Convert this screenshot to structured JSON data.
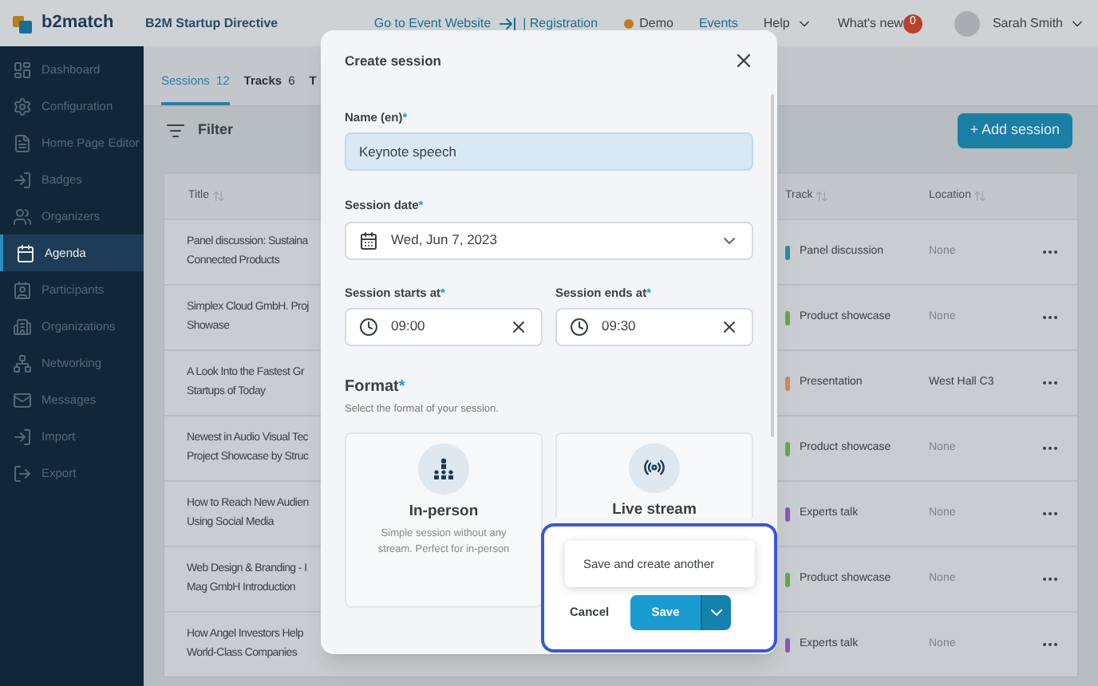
{
  "topbar": {
    "logo": "b2match",
    "event": "B2M Startup Directive",
    "links": [
      {
        "kind": "website",
        "label": "Go to Event Website"
      },
      {
        "kind": "registration",
        "label": "| Registration"
      },
      {
        "kind": "demo",
        "label": "Demo"
      },
      {
        "kind": "plain",
        "label": "Events"
      },
      {
        "kind": "menu",
        "label": "Help"
      },
      {
        "kind": "news",
        "label": "What's new",
        "badge": "0"
      }
    ],
    "user": "Sarah Smith"
  },
  "sidebar": {
    "items": [
      {
        "label": "Dashboard",
        "selected": false
      },
      {
        "label": "Configuration",
        "selected": false
      },
      {
        "label": "Home Page Editor",
        "selected": false
      },
      {
        "label": "Badges",
        "selected": false
      },
      {
        "label": "Organizers",
        "selected": false
      },
      {
        "label": "Agenda",
        "selected": true
      },
      {
        "label": "Participants",
        "selected": false
      },
      {
        "label": "Organizations",
        "selected": false
      },
      {
        "label": "Networking",
        "selected": false
      },
      {
        "label": "Messages",
        "selected": false
      },
      {
        "label": "Import",
        "selected": false
      },
      {
        "label": "Export",
        "selected": false
      }
    ]
  },
  "tabs": [
    {
      "label": "Sessions",
      "count": "12",
      "selected": true
    },
    {
      "label": "Tracks",
      "count": "6",
      "selected": false
    },
    {
      "label": "T",
      "selected": false
    }
  ],
  "filter": "Filter",
  "add_button": "+ Add session",
  "table": {
    "columns": [
      "Title",
      "Track",
      "Location"
    ],
    "rows": [
      {
        "title": [
          "Panel discussion: Sustaina",
          "Connected Products"
        ],
        "track": "Panel discussion",
        "color": "#2a8e9e",
        "location": "None"
      },
      {
        "title": [
          "Simplex Cloud GmbH. Proj",
          "Showase"
        ],
        "track": "Product showcase",
        "color": "#63a84a",
        "location": "None"
      },
      {
        "title": [
          "A Look Into the Fastest Gr",
          "Startups of Today"
        ],
        "track": "Presentation",
        "color": "#c98d5c",
        "location": "West Hall C3"
      },
      {
        "title": [
          "Newest in Audio Visual Tec",
          "Project Showcase by Struc"
        ],
        "track": "Product showcase",
        "color": "#63a84a",
        "location": "None"
      },
      {
        "title": [
          "How to Reach New Audien",
          "Using Social Media"
        ],
        "track": "Experts talk",
        "color": "#8a58b8",
        "location": "None"
      },
      {
        "title": [
          "Web Design & Branding - I",
          "Mag GmbH Introduction"
        ],
        "track": "Product showcase",
        "color": "#63a84a",
        "location": "None"
      },
      {
        "title": [
          "How Angel Investors Help",
          "World-Class Companies"
        ],
        "track": "Experts talk",
        "color": "#8a58b8",
        "location": "None"
      }
    ]
  },
  "modal": {
    "title": "Create session",
    "name_label": {
      "text": "Name (en)",
      "mark": "*"
    },
    "name_value": "Keynote speech",
    "date_label": {
      "text": "Session date",
      "mark": "*"
    },
    "date_value": "Wed, Jun 7, 2023",
    "start_label": {
      "text": "Session starts at",
      "mark": "*"
    },
    "start_value": "09:00",
    "end_label": {
      "text": "Session ends at",
      "mark": "*"
    },
    "end_value": "09:30",
    "format_title": {
      "text": "Format",
      "mark": "*"
    },
    "format_hint": "Select the format of your session.",
    "formats": [
      {
        "kind": "in-person",
        "title": "In-person",
        "description": "Simple session without any stream. Perfect for in-person"
      },
      {
        "kind": "stream",
        "title": "Live stream"
      }
    ],
    "menu_item": "Save and create another",
    "cancel": "Cancel",
    "save": "Save"
  }
}
